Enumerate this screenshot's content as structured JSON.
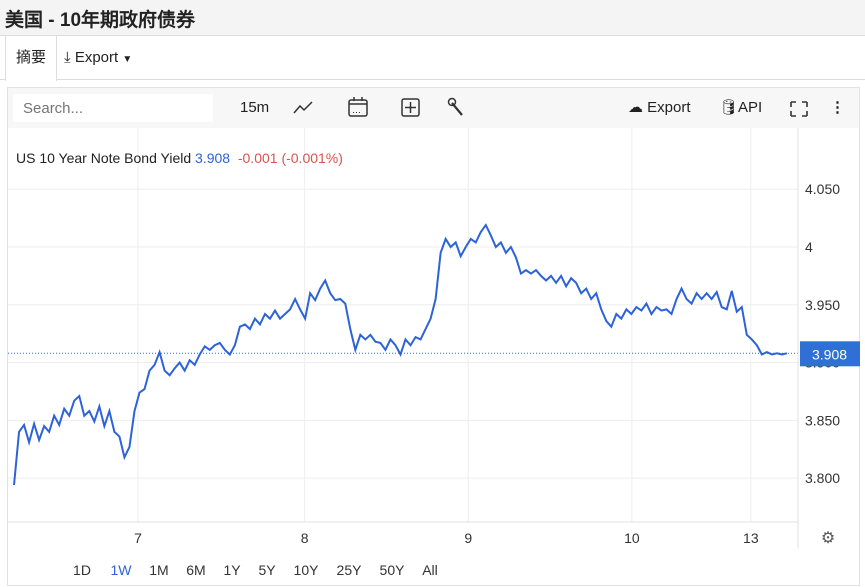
{
  "title": "美国 - 10年期政府债券",
  "tabs": {
    "summary": "摘要",
    "export": "Export"
  },
  "toolbar": {
    "search_placeholder": "Search...",
    "interval": "15m",
    "export": "Export",
    "api": "API"
  },
  "legend": {
    "name": "US 10 Year Note Bond Yield",
    "value": "3.908",
    "change": "-0.001 (-0.001%)"
  },
  "colors": {
    "line": "#2d63d8",
    "positive": "#2d63d8",
    "negative": "#d9534f",
    "price_tag": "#2f6fd6"
  },
  "ranges": [
    "1D",
    "1W",
    "1M",
    "6M",
    "1Y",
    "5Y",
    "10Y",
    "25Y",
    "50Y",
    "All"
  ],
  "active_range": "1W",
  "chart_data": {
    "type": "line",
    "title": "US 10 Year Note Bond Yield",
    "xlabel": "",
    "ylabel": "",
    "ylim": [
      3.762,
      4.103
    ],
    "y_ticks": [
      "3.800",
      "3.850",
      "3.900",
      "3.950",
      "4",
      "4.050"
    ],
    "y_tick_values": [
      3.8,
      3.85,
      3.9,
      3.95,
      4.0,
      4.05
    ],
    "x_ticks": [
      {
        "label": "7",
        "index": 24.7
      },
      {
        "label": "8",
        "index": 57.9
      },
      {
        "label": "9",
        "index": 90.5
      },
      {
        "label": "10",
        "index": 123.1
      },
      {
        "label": "13",
        "index": 146.8
      }
    ],
    "x_range": [
      -1.2,
      156.2
    ],
    "last_value": "3.908",
    "series": [
      {
        "name": "US 10 Year Note Bond Yield",
        "values": [
          3.794,
          3.84,
          3.846,
          3.831,
          3.847,
          3.833,
          3.845,
          3.84,
          3.854,
          3.846,
          3.86,
          3.854,
          3.867,
          3.871,
          3.854,
          3.858,
          3.849,
          3.862,
          3.845,
          3.858,
          3.84,
          3.836,
          3.818,
          3.827,
          3.858,
          3.874,
          3.877,
          3.893,
          3.898,
          3.909,
          3.893,
          3.889,
          3.895,
          3.9,
          3.893,
          3.902,
          3.898,
          3.907,
          3.914,
          3.911,
          3.915,
          3.917,
          3.911,
          3.907,
          3.915,
          3.931,
          3.933,
          3.929,
          3.938,
          3.933,
          3.942,
          3.938,
          3.945,
          3.938,
          3.942,
          3.946,
          3.955,
          3.946,
          3.938,
          3.96,
          3.954,
          3.964,
          3.971,
          3.96,
          3.954,
          3.955,
          3.951,
          3.929,
          3.911,
          3.924,
          3.92,
          3.924,
          3.918,
          3.917,
          3.911,
          3.92,
          3.915,
          3.907,
          3.92,
          3.915,
          3.922,
          3.92,
          3.929,
          3.938,
          3.955,
          3.995,
          4.007,
          4.0,
          4.004,
          3.992,
          4.0,
          4.007,
          4.004,
          4.013,
          4.019,
          4.01,
          4.0,
          4.004,
          3.995,
          4.0,
          3.991,
          3.977,
          3.98,
          3.977,
          3.98,
          3.975,
          3.971,
          3.975,
          3.969,
          3.975,
          3.966,
          3.973,
          3.969,
          3.96,
          3.964,
          3.955,
          3.96,
          3.946,
          3.936,
          3.931,
          3.942,
          3.938,
          3.946,
          3.942,
          3.948,
          3.945,
          3.951,
          3.942,
          3.948,
          3.945,
          3.946,
          3.942,
          3.955,
          3.964,
          3.955,
          3.951,
          3.96,
          3.955,
          3.96,
          3.955,
          3.961,
          3.948,
          3.946,
          3.962,
          3.944,
          3.948,
          3.924,
          3.92,
          3.915,
          3.907,
          3.909,
          3.907,
          3.908,
          3.907,
          3.908
        ]
      }
    ]
  }
}
